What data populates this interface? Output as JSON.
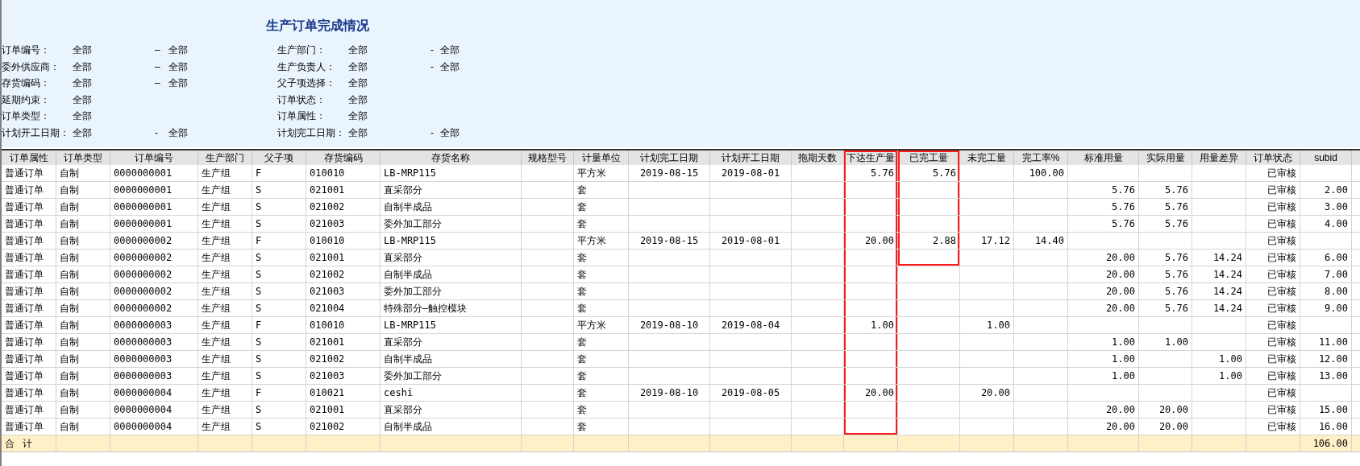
{
  "report": {
    "title": "生产订单完成情况",
    "filters_left": [
      {
        "label": "订单编号：",
        "from": "全部",
        "separator": "–",
        "to": "全部"
      },
      {
        "label": "委外供应商：",
        "from": "全部",
        "separator": "–",
        "to": "全部"
      },
      {
        "label": "存货编码：",
        "from": "全部",
        "separator": "–",
        "to": "全部"
      },
      {
        "label": "延期约束：",
        "from": "全部"
      },
      {
        "label": "订单类型：",
        "from": "全部"
      },
      {
        "label": "计划开工日期：",
        "from": "全部",
        "separator": "-",
        "to": "全部"
      }
    ],
    "filters_right": [
      {
        "label": "生产部门：",
        "from": "全部",
        "separator": "-",
        "to": "全部"
      },
      {
        "label": "生产负责人：",
        "from": "全部",
        "separator": "-",
        "to": "全部"
      },
      {
        "label": "父子项选择：",
        "from": "全部"
      },
      {
        "label": "订单状态：",
        "from": "全部"
      },
      {
        "label": "订单属性：",
        "from": "全部"
      },
      {
        "label": "计划完工日期：",
        "from": "全部",
        "separator": "-",
        "to": "全部"
      }
    ]
  },
  "table": {
    "columns": [
      {
        "label": "订单属性",
        "boxed": false
      },
      {
        "label": "订单类型",
        "boxed": false
      },
      {
        "label": "订单编号",
        "boxed": false
      },
      {
        "label": "生产部门",
        "boxed": false
      },
      {
        "label": "父子项",
        "boxed": false
      },
      {
        "label": "存货编码",
        "boxed": false
      },
      {
        "label": "存货名称",
        "boxed": false
      },
      {
        "label": "规格型号",
        "boxed": false
      },
      {
        "label": "计量单位",
        "boxed": false
      },
      {
        "label": "计划完工日期",
        "boxed": false
      },
      {
        "label": "计划开工日期",
        "boxed": false
      },
      {
        "label": "拖期天数",
        "boxed": false
      },
      {
        "label": "下达生产量",
        "boxed": true
      },
      {
        "label": "已完工量",
        "boxed": true
      },
      {
        "label": "未完工量",
        "boxed": false
      },
      {
        "label": "完工率%",
        "boxed": false
      },
      {
        "label": "标准用量",
        "boxed": false
      },
      {
        "label": "实际用量",
        "boxed": false
      },
      {
        "label": "用量差异",
        "boxed": false
      },
      {
        "label": "订单状态",
        "boxed": false
      },
      {
        "label": "subid",
        "boxed": false
      }
    ],
    "rows": [
      {
        "cells": [
          "普通订单",
          "自制",
          "0000000001",
          "生产组",
          "F",
          "010010",
          "LB-MRP115",
          null,
          "平方米",
          "2019-08-15",
          "2019-08-01",
          null,
          "5.76",
          "5.76",
          null,
          "100.00",
          null,
          null,
          null,
          "已审核",
          null
        ],
        "boxed": [
          true,
          true
        ]
      },
      {
        "cells": [
          "普通订单",
          "自制",
          "0000000001",
          "生产组",
          "S",
          "021001",
          "直采部分",
          null,
          "套",
          null,
          null,
          null,
          null,
          null,
          null,
          null,
          "5.76",
          "5.76",
          null,
          "已审核",
          "2.00"
        ],
        "boxed": [
          true,
          true
        ]
      },
      {
        "cells": [
          "普通订单",
          "自制",
          "0000000001",
          "生产组",
          "S",
          "021002",
          "自制半成品",
          null,
          "套",
          null,
          null,
          null,
          null,
          null,
          null,
          null,
          "5.76",
          "5.76",
          null,
          "已审核",
          "3.00"
        ],
        "boxed": [
          true,
          true
        ]
      },
      {
        "cells": [
          "普通订单",
          "自制",
          "0000000001",
          "生产组",
          "S",
          "021003",
          "委外加工部分",
          null,
          "套",
          null,
          null,
          null,
          null,
          null,
          null,
          null,
          "5.76",
          "5.76",
          null,
          "已审核",
          "4.00"
        ],
        "boxed": [
          true,
          true
        ]
      },
      {
        "cells": [
          "普通订单",
          "自制",
          "0000000002",
          "生产组",
          "F",
          "010010",
          "LB-MRP115",
          null,
          "平方米",
          "2019-08-15",
          "2019-08-01",
          null,
          "20.00",
          "2.88",
          "17.12",
          "14.40",
          null,
          null,
          null,
          "已审核",
          null
        ],
        "boxed": [
          true,
          true
        ]
      },
      {
        "cells": [
          "普通订单",
          "自制",
          "0000000002",
          "生产组",
          "S",
          "021001",
          "直采部分",
          null,
          "套",
          null,
          null,
          null,
          null,
          null,
          null,
          null,
          "20.00",
          "5.76",
          "14.24",
          "已审核",
          "6.00"
        ],
        "boxed": [
          true,
          true
        ]
      },
      {
        "cells": [
          "普通订单",
          "自制",
          "0000000002",
          "生产组",
          "S",
          "021002",
          "自制半成品",
          null,
          "套",
          null,
          null,
          null,
          null,
          null,
          null,
          null,
          "20.00",
          "5.76",
          "14.24",
          "已审核",
          "7.00"
        ],
        "boxed": [
          true,
          false
        ]
      },
      {
        "cells": [
          "普通订单",
          "自制",
          "0000000002",
          "生产组",
          "S",
          "021003",
          "委外加工部分",
          null,
          "套",
          null,
          null,
          null,
          null,
          null,
          null,
          null,
          "20.00",
          "5.76",
          "14.24",
          "已审核",
          "8.00"
        ],
        "boxed": [
          true,
          false
        ]
      },
      {
        "cells": [
          "普通订单",
          "自制",
          "0000000002",
          "生产组",
          "S",
          "021004",
          "特殊部分—触控模块",
          null,
          "套",
          null,
          null,
          null,
          null,
          null,
          null,
          null,
          "20.00",
          "5.76",
          "14.24",
          "已审核",
          "9.00"
        ],
        "boxed": [
          true,
          false
        ]
      },
      {
        "cells": [
          "普通订单",
          "自制",
          "0000000003",
          "生产组",
          "F",
          "010010",
          "LB-MRP115",
          null,
          "平方米",
          "2019-08-10",
          "2019-08-04",
          null,
          "1.00",
          null,
          "1.00",
          null,
          null,
          null,
          null,
          "已审核",
          null
        ],
        "boxed": [
          true,
          false
        ]
      },
      {
        "cells": [
          "普通订单",
          "自制",
          "0000000003",
          "生产组",
          "S",
          "021001",
          "直采部分",
          null,
          "套",
          null,
          null,
          null,
          null,
          null,
          null,
          null,
          "1.00",
          "1.00",
          null,
          "已审核",
          "11.00"
        ],
        "boxed": [
          true,
          false
        ]
      },
      {
        "cells": [
          "普通订单",
          "自制",
          "0000000003",
          "生产组",
          "S",
          "021002",
          "自制半成品",
          null,
          "套",
          null,
          null,
          null,
          null,
          null,
          null,
          null,
          "1.00",
          null,
          "1.00",
          "已审核",
          "12.00"
        ],
        "boxed": [
          true,
          false
        ]
      },
      {
        "cells": [
          "普通订单",
          "自制",
          "0000000003",
          "生产组",
          "S",
          "021003",
          "委外加工部分",
          null,
          "套",
          null,
          null,
          null,
          null,
          null,
          null,
          null,
          "1.00",
          null,
          "1.00",
          "已审核",
          "13.00"
        ],
        "boxed": [
          true,
          false
        ]
      },
      {
        "cells": [
          "普通订单",
          "自制",
          "0000000004",
          "生产组",
          "F",
          "010021",
          "ceshi",
          null,
          "套",
          "2019-08-10",
          "2019-08-05",
          null,
          "20.00",
          null,
          "20.00",
          null,
          null,
          null,
          null,
          "已审核",
          null
        ],
        "boxed": [
          true,
          false
        ]
      },
      {
        "cells": [
          "普通订单",
          "自制",
          "0000000004",
          "生产组",
          "S",
          "021001",
          "直采部分",
          null,
          "套",
          null,
          null,
          null,
          null,
          null,
          null,
          null,
          "20.00",
          "20.00",
          null,
          "已审核",
          "15.00"
        ],
        "boxed": [
          true,
          false
        ]
      },
      {
        "cells": [
          "普通订单",
          "自制",
          "0000000004",
          "生产组",
          "S",
          "021002",
          "自制半成品",
          null,
          "套",
          null,
          null,
          null,
          null,
          null,
          null,
          null,
          "20.00",
          "20.00",
          null,
          "已审核",
          "16.00"
        ],
        "boxed": [
          true,
          false
        ]
      }
    ],
    "total": {
      "label": "合   计",
      "cells": [
        null,
        null,
        null,
        null,
        null,
        null,
        null,
        null,
        null,
        null,
        null,
        null,
        null,
        null,
        null,
        null,
        null,
        null,
        null,
        "106.00"
      ]
    }
  }
}
